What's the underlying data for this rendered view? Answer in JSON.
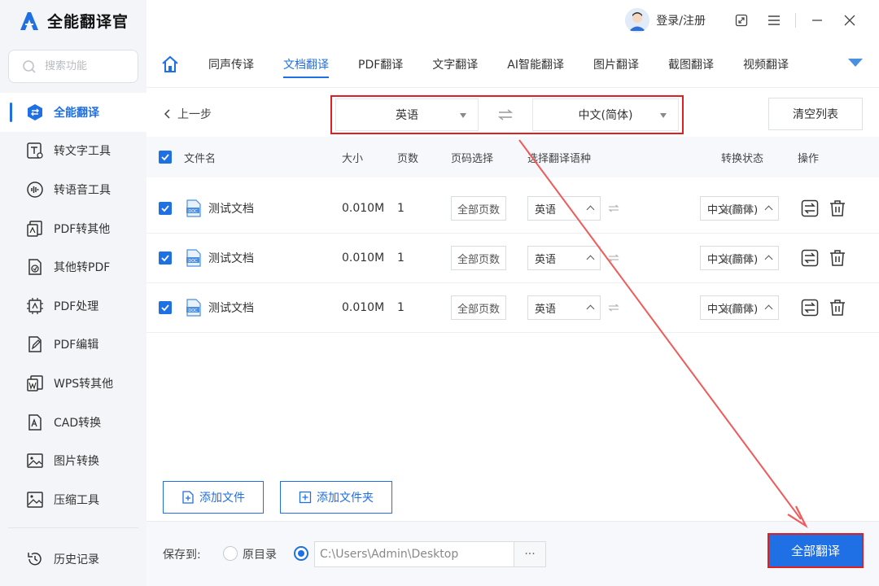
{
  "app": {
    "title": "全能翻译官"
  },
  "search": {
    "placeholder": "搜索功能"
  },
  "sidebar": {
    "items": [
      {
        "label": "全能翻译",
        "icon": "translate-icon",
        "active": true
      },
      {
        "label": "转文字工具",
        "icon": "text-tool-icon"
      },
      {
        "label": "转语音工具",
        "icon": "voice-tool-icon"
      },
      {
        "label": "PDF转其他",
        "icon": "pdf-convert-icon"
      },
      {
        "label": "其他转PDF",
        "icon": "to-pdf-icon"
      },
      {
        "label": "PDF处理",
        "icon": "pdf-process-icon"
      },
      {
        "label": "PDF编辑",
        "icon": "pdf-edit-icon"
      },
      {
        "label": "WPS转其他",
        "icon": "wps-icon"
      },
      {
        "label": "CAD转换",
        "icon": "cad-icon"
      },
      {
        "label": "图片转换",
        "icon": "image-convert-icon"
      },
      {
        "label": "压缩工具",
        "icon": "compress-icon"
      }
    ],
    "history": "历史记录"
  },
  "header": {
    "login": "登录/注册"
  },
  "tabs": [
    "同声传译",
    "文档翻译",
    "PDF翻译",
    "文字翻译",
    "AI智能翻译",
    "图片翻译",
    "截图翻译",
    "视频翻译"
  ],
  "toolbar": {
    "back": "上一步",
    "source_lang": "英语",
    "target_lang": "中文(简体)",
    "clear": "清空列表"
  },
  "table": {
    "headers": {
      "name": "文件名",
      "size": "大小",
      "pages": "页数",
      "page_select": "页码选择",
      "lang_select": "选择翻译语种",
      "status": "转换状态",
      "action": "操作"
    },
    "rows": [
      {
        "name": "测试文档",
        "size": "0.010M",
        "pages": "1",
        "page_select": "全部页数",
        "src": "英语",
        "dst": "中文(简体)",
        "status": "未翻译"
      },
      {
        "name": "测试文档",
        "size": "0.010M",
        "pages": "1",
        "page_select": "全部页数",
        "src": "英语",
        "dst": "中文(简体)",
        "status": "未翻译"
      },
      {
        "name": "测试文档",
        "size": "0.010M",
        "pages": "1",
        "page_select": "全部页数",
        "src": "英语",
        "dst": "中文(简体)",
        "status": "未翻译"
      }
    ]
  },
  "bottom": {
    "add_file": "添加文件",
    "add_folder": "添加文件夹",
    "save_to": "保存到:",
    "original_dir": "原目录",
    "path": "C:\\Users\\Admin\\Desktop",
    "more": "···",
    "translate_all": "全部翻译"
  },
  "colors": {
    "accent": "#1f6fe5",
    "highlight": "#e02020",
    "arrow": "#f05a5a"
  }
}
